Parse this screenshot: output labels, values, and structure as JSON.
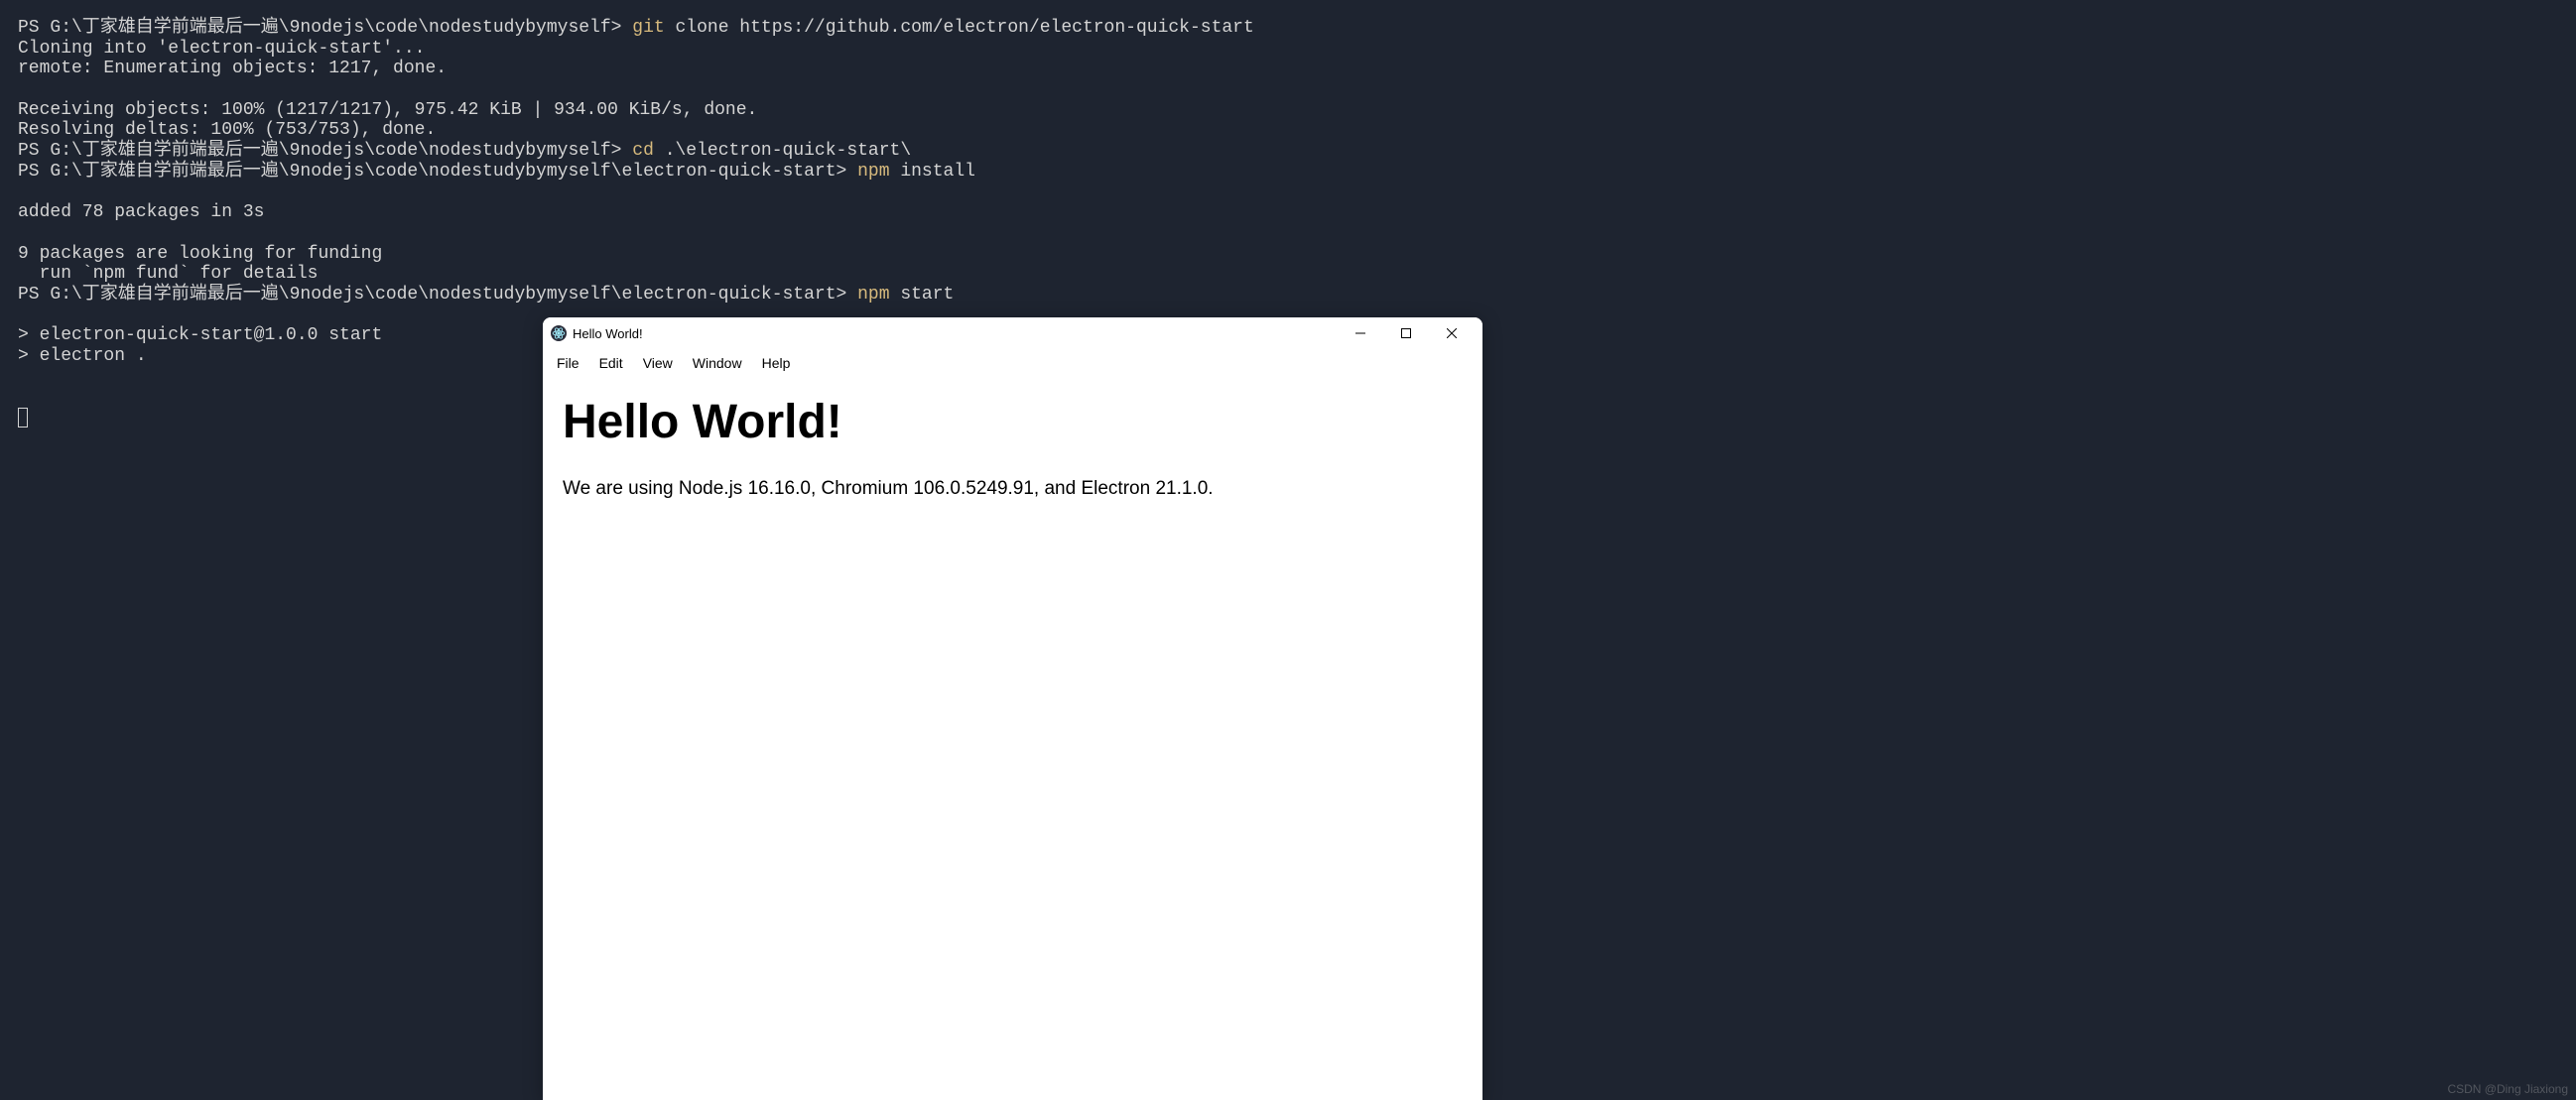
{
  "terminal": {
    "lines": [
      {
        "prompt": "PS ",
        "path": "G:\\丁家雄自学前端最后一遍\\9nodejs\\code\\nodestudybymyself> ",
        "cmd": "git",
        "args": " clone https://github.com/electron/electron-quick-start"
      },
      {
        "output": "Cloning into 'electron-quick-start'..."
      },
      {
        "output": "remote: Enumerating objects: 1217, done."
      },
      {
        "output": ""
      },
      {
        "output": "Receiving objects: 100% (1217/1217), 975.42 KiB | 934.00 KiB/s, done."
      },
      {
        "output": "Resolving deltas: 100% (753/753), done."
      },
      {
        "prompt": "PS ",
        "path": "G:\\丁家雄自学前端最后一遍\\9nodejs\\code\\nodestudybymyself> ",
        "cmd": "cd",
        "args": " .\\electron-quick-start\\"
      },
      {
        "prompt": "PS ",
        "path": "G:\\丁家雄自学前端最后一遍\\9nodejs\\code\\nodestudybymyself\\electron-quick-start> ",
        "cmd": "npm",
        "args": " install"
      },
      {
        "output": ""
      },
      {
        "output": "added 78 packages in 3s"
      },
      {
        "output": ""
      },
      {
        "output": "9 packages are looking for funding"
      },
      {
        "output": "  run `npm fund` for details"
      },
      {
        "prompt": "PS ",
        "path": "G:\\丁家雄自学前端最后一遍\\9nodejs\\code\\nodestudybymyself\\electron-quick-start> ",
        "cmd": "npm",
        "args": " start"
      },
      {
        "output": ""
      },
      {
        "output": "> electron-quick-start@1.0.0 start"
      },
      {
        "output": "> electron ."
      },
      {
        "output": ""
      },
      {
        "output": ""
      }
    ]
  },
  "electron": {
    "title": "Hello World!",
    "menubar": [
      "File",
      "Edit",
      "View",
      "Window",
      "Help"
    ],
    "heading": "Hello World!",
    "body": "We are using Node.js 16.16.0, Chromium 106.0.5249.91, and Electron 21.1.0."
  },
  "watermark": "CSDN @Ding Jiaxiong"
}
